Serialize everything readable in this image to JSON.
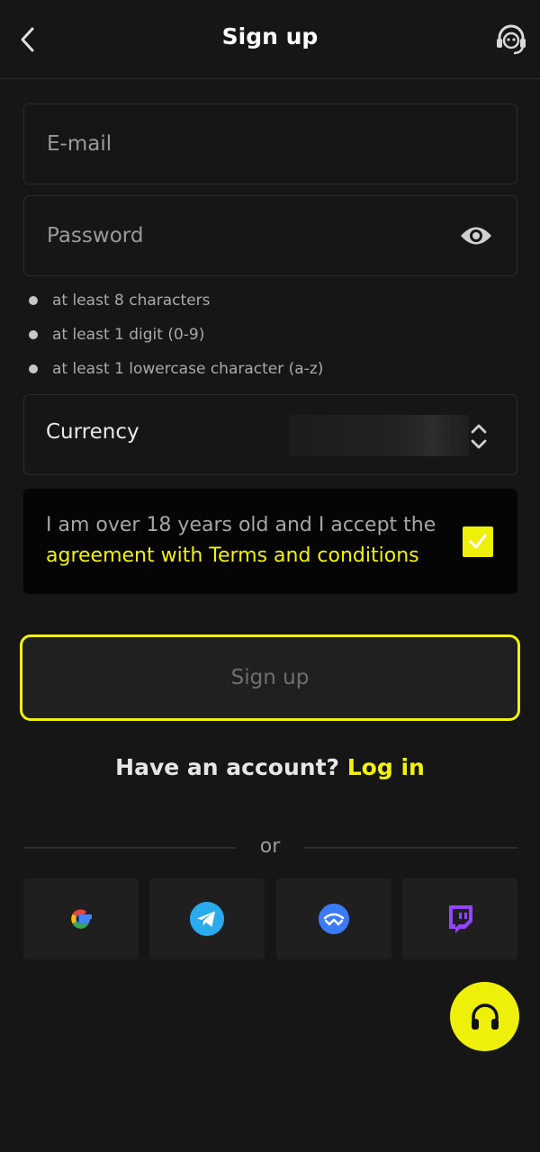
{
  "header": {
    "title": "Sign up",
    "back_icon": "chevron-left-icon",
    "support_icon": "headset-support-icon"
  },
  "form": {
    "email_placeholder": "E-mail",
    "email_value": "",
    "password_placeholder": "Password",
    "password_value": "",
    "password_rules": [
      "at least 8 characters",
      "at least 1 digit (0-9)",
      "at least 1 lowercase character (a-z)"
    ],
    "currency_label": "Currency",
    "currency_value": ""
  },
  "terms": {
    "prefix": "I am over 18 years old and I accept the",
    "link": "agreement with Terms and conditions",
    "checked": true
  },
  "signup_button": "Sign up",
  "login": {
    "prompt": "Have an account?",
    "link": "Log in"
  },
  "divider": "or",
  "social": [
    "google-icon",
    "telegram-icon",
    "walletconnect-icon",
    "twitch-icon"
  ],
  "colors": {
    "accent": "#f2f20c",
    "background": "#161616"
  }
}
